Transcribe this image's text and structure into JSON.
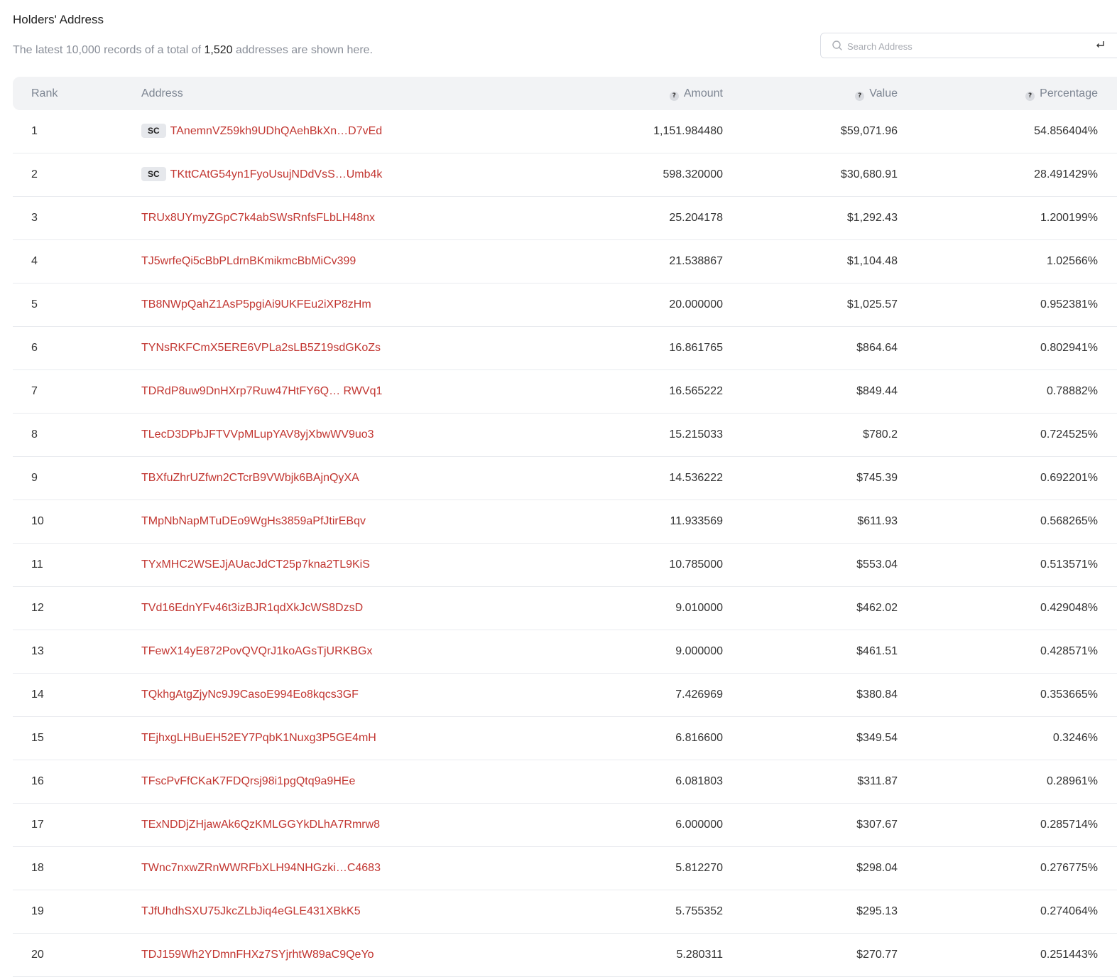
{
  "header": {
    "title": "Holders' Address",
    "subtitle_prefix": "The latest 10,000 records of a total of ",
    "total_addresses": "1,520",
    "subtitle_suffix": " addresses are shown here."
  },
  "search": {
    "placeholder": "Search Address",
    "value": ""
  },
  "icons": {
    "search": "search-icon",
    "enter": "enter-icon",
    "help": "question-circle-icon"
  },
  "colors": {
    "link": "#c23631",
    "header_bg": "#f2f3f5",
    "muted_text": "#8a8f99"
  },
  "table": {
    "columns": {
      "rank": "Rank",
      "address": "Address",
      "amount": "Amount",
      "value": "Value",
      "percentage": "Percentage"
    },
    "help_glyph": "?",
    "rows": [
      {
        "rank": "1",
        "badge": "SC",
        "address": "TAnemnVZ59kh9UDhQAehBkXn…D7vEd",
        "amount": "1,151.984480",
        "value": "$59,071.96",
        "percentage": "54.856404%"
      },
      {
        "rank": "2",
        "badge": "SC",
        "address": "TKttCAtG54yn1FyoUsujNDdVsS…Umb4k",
        "amount": "598.320000",
        "value": "$30,680.91",
        "percentage": "28.491429%"
      },
      {
        "rank": "3",
        "badge": "",
        "address": "TRUx8UYmyZGpC7k4abSWsRnfsFLbLH48nx",
        "amount": "25.204178",
        "value": "$1,292.43",
        "percentage": "1.200199%"
      },
      {
        "rank": "4",
        "badge": "",
        "address": "TJ5wrfeQi5cBbPLdrnBKmikmcBbMiCv399",
        "amount": "21.538867",
        "value": "$1,104.48",
        "percentage": "1.02566%"
      },
      {
        "rank": "5",
        "badge": "",
        "address": "TB8NWpQahZ1AsP5pgiAi9UKFEu2iXP8zHm",
        "amount": "20.000000",
        "value": "$1,025.57",
        "percentage": "0.952381%"
      },
      {
        "rank": "6",
        "badge": "",
        "address": "TYNsRKFCmX5ERE6VPLa2sLB5Z19sdGKoZs",
        "amount": "16.861765",
        "value": "$864.64",
        "percentage": "0.802941%"
      },
      {
        "rank": "7",
        "badge": "",
        "address": "TDRdP8uw9DnHXrp7Ruw47HtFY6Q… RWVq1",
        "amount": "16.565222",
        "value": "$849.44",
        "percentage": "0.78882%"
      },
      {
        "rank": "8",
        "badge": "",
        "address": "TLecD3DPbJFTVVpMLupYAV8yjXbwWV9uo3",
        "amount": "15.215033",
        "value": "$780.2",
        "percentage": "0.724525%"
      },
      {
        "rank": "9",
        "badge": "",
        "address": "TBXfuZhrUZfwn2CTcrB9VWbjk6BAjnQyXA",
        "amount": "14.536222",
        "value": "$745.39",
        "percentage": "0.692201%"
      },
      {
        "rank": "10",
        "badge": "",
        "address": "TMpNbNapMTuDEo9WgHs3859aPfJtirEBqv",
        "amount": "11.933569",
        "value": "$611.93",
        "percentage": "0.568265%"
      },
      {
        "rank": "11",
        "badge": "",
        "address": "TYxMHC2WSEJjAUacJdCT25p7kna2TL9KiS",
        "amount": "10.785000",
        "value": "$553.04",
        "percentage": "0.513571%"
      },
      {
        "rank": "12",
        "badge": "",
        "address": "TVd16EdnYFv46t3izBJR1qdXkJcWS8DzsD",
        "amount": "9.010000",
        "value": "$462.02",
        "percentage": "0.429048%"
      },
      {
        "rank": "13",
        "badge": "",
        "address": "TFewX14yE872PovQVQrJ1koAGsTjURKBGx",
        "amount": "9.000000",
        "value": "$461.51",
        "percentage": "0.428571%"
      },
      {
        "rank": "14",
        "badge": "",
        "address": "TQkhgAtgZjyNc9J9CasoE994Eo8kqcs3GF",
        "amount": "7.426969",
        "value": "$380.84",
        "percentage": "0.353665%"
      },
      {
        "rank": "15",
        "badge": "",
        "address": "TEjhxgLHBuEH52EY7PqbK1Nuxg3P5GE4mH",
        "amount": "6.816600",
        "value": "$349.54",
        "percentage": "0.3246%"
      },
      {
        "rank": "16",
        "badge": "",
        "address": "TFscPvFfCKaK7FDQrsj98i1pgQtq9a9HEe",
        "amount": "6.081803",
        "value": "$311.87",
        "percentage": "0.28961%"
      },
      {
        "rank": "17",
        "badge": "",
        "address": "TExNDDjZHjawAk6QzKMLGGYkDLhA7Rmrw8",
        "amount": "6.000000",
        "value": "$307.67",
        "percentage": "0.285714%"
      },
      {
        "rank": "18",
        "badge": "",
        "address": "TWnc7nxwZRnWWRFbXLH94NHGzki…C4683",
        "amount": "5.812270",
        "value": "$298.04",
        "percentage": "0.276775%"
      },
      {
        "rank": "19",
        "badge": "",
        "address": "TJfUhdhSXU75JkcZLbJiq4eGLE431XBkK5",
        "amount": "5.755352",
        "value": "$295.13",
        "percentage": "0.274064%"
      },
      {
        "rank": "20",
        "badge": "",
        "address": "TDJ159Wh2YDmnFHXz7SYjrhtW89aC9QeYo",
        "amount": "5.280311",
        "value": "$270.77",
        "percentage": "0.251443%"
      }
    ]
  }
}
